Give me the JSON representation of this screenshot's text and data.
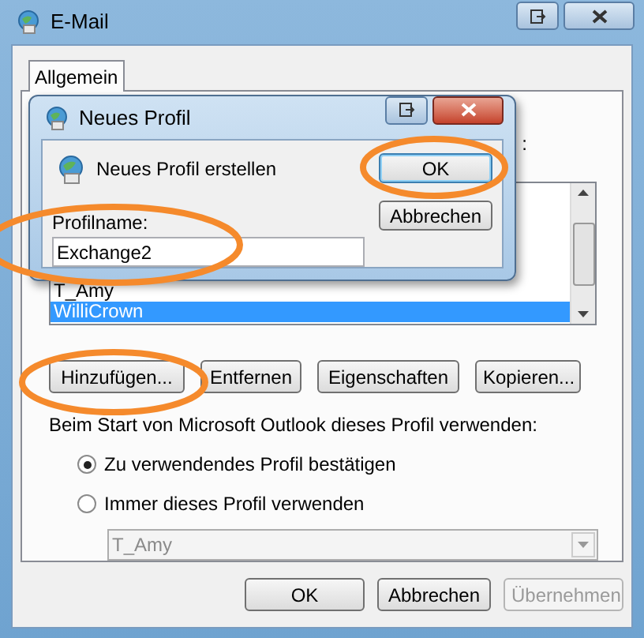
{
  "window": {
    "title": "E-Mail"
  },
  "tabs": [
    {
      "label": "Allgemein",
      "selected": true
    }
  ],
  "profiles_label_tail": ":",
  "profile_list": {
    "items": [
      {
        "label": "T_Amy",
        "selected": false
      },
      {
        "label": "WilliCrown",
        "selected": true
      }
    ]
  },
  "profile_buttons": [
    {
      "label": "Hinzufügen..."
    },
    {
      "label": "Entfernen"
    },
    {
      "label": "Eigenschaften"
    },
    {
      "label": "Kopieren..."
    }
  ],
  "startup": {
    "label": "Beim Start von Microsoft Outlook dieses Profil verwenden:",
    "options": [
      {
        "label": "Zu verwendendes Profil bestätigen",
        "selected": true
      },
      {
        "label": "Immer dieses Profil verwenden",
        "selected": false
      }
    ],
    "profile_select": {
      "value": "T_Amy",
      "disabled": true
    }
  },
  "footer_buttons": [
    {
      "label": "OK",
      "disabled": false
    },
    {
      "label": "Abbrechen",
      "disabled": false
    },
    {
      "label": "Übernehmen",
      "disabled": true
    }
  ],
  "dialog": {
    "title": "Neues Profil",
    "heading": "Neues Profil erstellen",
    "buttons": [
      {
        "label": "OK",
        "default": true
      },
      {
        "label": "Abbrechen",
        "default": false
      }
    ],
    "field": {
      "label": "Profilname:",
      "value": "Exchange2"
    }
  }
}
